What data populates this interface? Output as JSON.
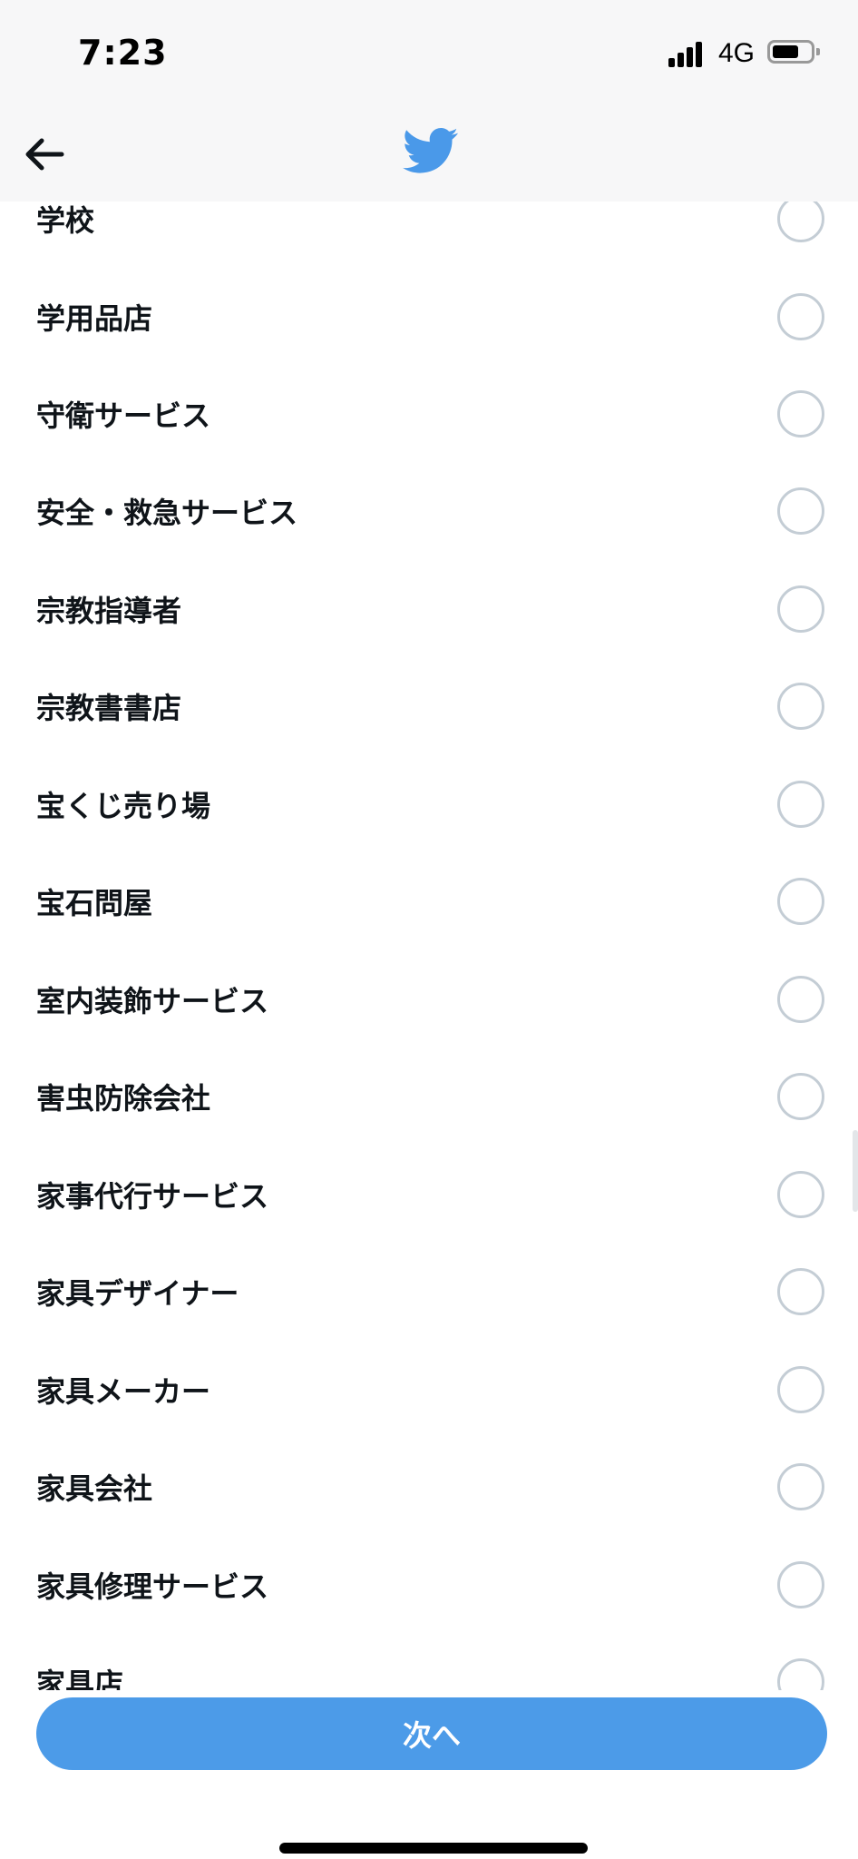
{
  "status_bar": {
    "time": "7:23",
    "network": "4G"
  },
  "nav": {
    "back_icon": "arrow-left-icon",
    "logo_icon": "twitter-bird-icon",
    "logo_color": "#4a99e9"
  },
  "categories": [
    {
      "label": "学校"
    },
    {
      "label": "学用品店"
    },
    {
      "label": "守衛サービス"
    },
    {
      "label": "安全・救急サービス"
    },
    {
      "label": "宗教指導者"
    },
    {
      "label": "宗教書書店"
    },
    {
      "label": "宝くじ売り場"
    },
    {
      "label": "宝石問屋"
    },
    {
      "label": "室内装飾サービス"
    },
    {
      "label": "害虫防除会社"
    },
    {
      "label": "家事代行サービス"
    },
    {
      "label": "家具デザイナー"
    },
    {
      "label": "家具メーカー"
    },
    {
      "label": "家具会社"
    },
    {
      "label": "家具修理サービス"
    },
    {
      "label": "家具店"
    }
  ],
  "footer": {
    "next_label": "次へ",
    "button_color": "#4c9be8"
  }
}
